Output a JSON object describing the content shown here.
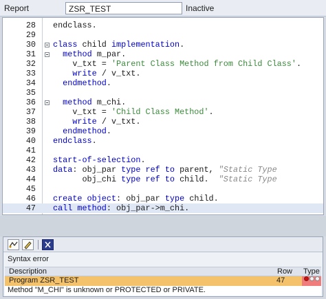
{
  "report": {
    "label": "Report",
    "name": "ZSR_TEST",
    "status": "Inactive"
  },
  "editor": {
    "lines": [
      {
        "num": "28",
        "code": [
          [
            "",
            "endclass."
          ]
        ],
        "fold": false
      },
      {
        "num": "29",
        "code": [],
        "fold": false
      },
      {
        "num": "30",
        "code": [
          [
            "kw",
            "class"
          ],
          [
            "",
            " child "
          ],
          [
            "kw",
            "implementation"
          ],
          [
            "",
            "."
          ]
        ],
        "fold": true
      },
      {
        "num": "31",
        "code": [
          [
            "",
            "  "
          ],
          [
            "kw",
            "method"
          ],
          [
            "",
            " m_par."
          ]
        ],
        "fold": true
      },
      {
        "num": "32",
        "code": [
          [
            "",
            "    v_txt = "
          ],
          [
            "str",
            "'Parent Class Method from Child Class'"
          ],
          [
            "",
            "."
          ]
        ],
        "fold": false
      },
      {
        "num": "33",
        "code": [
          [
            "",
            "    "
          ],
          [
            "kw",
            "write"
          ],
          [
            "",
            " / v_txt."
          ]
        ],
        "fold": false
      },
      {
        "num": "34",
        "code": [
          [
            "",
            "  "
          ],
          [
            "kw",
            "endmethod"
          ],
          [
            "",
            "."
          ]
        ],
        "fold": false
      },
      {
        "num": "35",
        "code": [],
        "fold": false
      },
      {
        "num": "36",
        "code": [
          [
            "",
            "  "
          ],
          [
            "kw",
            "method"
          ],
          [
            "",
            " m_chi."
          ]
        ],
        "fold": true
      },
      {
        "num": "37",
        "code": [
          [
            "",
            "    v_txt = "
          ],
          [
            "str",
            "'Child Class Method'"
          ],
          [
            "",
            "."
          ]
        ],
        "fold": false
      },
      {
        "num": "38",
        "code": [
          [
            "",
            "    "
          ],
          [
            "kw",
            "write"
          ],
          [
            "",
            " / v_txt."
          ]
        ],
        "fold": false
      },
      {
        "num": "39",
        "code": [
          [
            "",
            "  "
          ],
          [
            "kw",
            "endmethod"
          ],
          [
            "",
            "."
          ]
        ],
        "fold": false
      },
      {
        "num": "40",
        "code": [
          [
            "kw",
            "endclass"
          ],
          [
            "",
            "."
          ]
        ],
        "fold": false
      },
      {
        "num": "41",
        "code": [],
        "fold": false
      },
      {
        "num": "42",
        "code": [
          [
            "kw",
            "start-of-selection"
          ],
          [
            "",
            "."
          ]
        ],
        "fold": false
      },
      {
        "num": "43",
        "code": [
          [
            "kw",
            "data"
          ],
          [
            "",
            ": obj_par "
          ],
          [
            "kw",
            "type ref to"
          ],
          [
            "",
            " parent, "
          ],
          [
            "cmt",
            "\"Static Type"
          ]
        ],
        "fold": false
      },
      {
        "num": "44",
        "code": [
          [
            "",
            "      obj_chi "
          ],
          [
            "kw",
            "type ref to"
          ],
          [
            "",
            " child.  "
          ],
          [
            "cmt",
            "\"Static Type"
          ]
        ],
        "fold": false
      },
      {
        "num": "45",
        "code": [],
        "fold": false
      },
      {
        "num": "46",
        "code": [
          [
            "kw",
            "create object"
          ],
          [
            "",
            ": obj_par "
          ],
          [
            "kw",
            "type"
          ],
          [
            "",
            " child."
          ]
        ],
        "fold": false
      },
      {
        "num": "47",
        "code": [
          [
            "kw",
            "call method"
          ],
          [
            "",
            ": obj_par->m_chi."
          ]
        ],
        "fold": false,
        "current": true
      }
    ]
  },
  "errors": {
    "title": "Syntax error",
    "columns": {
      "description": "Description",
      "row": "Row",
      "type": "Type"
    },
    "program": "Program ZSR_TEST",
    "row": "47",
    "message": "Method \"M_CHI\" is unknown or PROTECTED or PRIVATE."
  },
  "colors": {
    "keyword": "#0000c8",
    "string": "#3c8a3c",
    "comment": "#8a8a8a",
    "error_row": "#f3c26b",
    "error_type": "#f07c7c"
  }
}
